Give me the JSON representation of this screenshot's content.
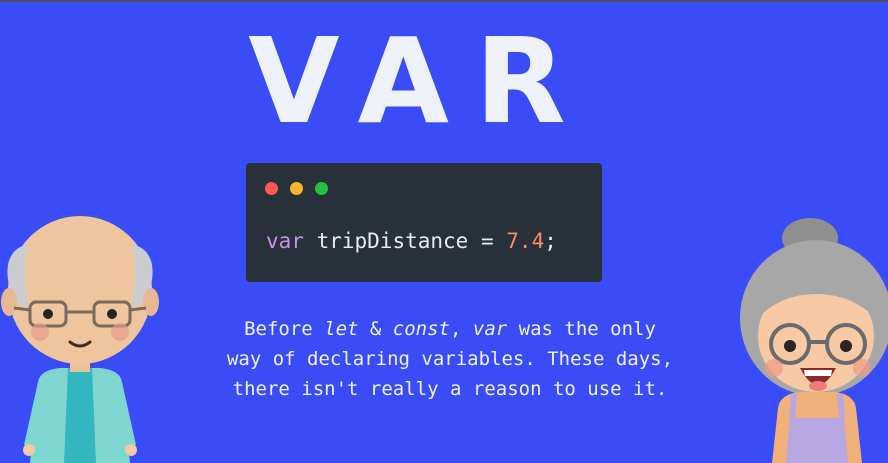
{
  "title": "VAR",
  "code": {
    "keyword": "var",
    "identifier": "tripDistance",
    "operator": "=",
    "number": "7.4",
    "terminator": ";"
  },
  "description": {
    "part1": "Before ",
    "let": "let",
    "amp": " & ",
    "const": "const",
    "comma": ", ",
    "var": "var",
    "rest_line1": " was the only",
    "line2": "way of declaring variables. These days,",
    "line3": "there isn't really a reason to use it."
  },
  "colors": {
    "background": "#3a4cf5",
    "code_bg": "#283139",
    "keyword": "#c792ea",
    "number": "#f78c6c",
    "dot_red": "#fd5656",
    "dot_yellow": "#f6b52a",
    "dot_green": "#27c140"
  },
  "characters": [
    "old-man-illustration",
    "old-woman-illustration"
  ]
}
